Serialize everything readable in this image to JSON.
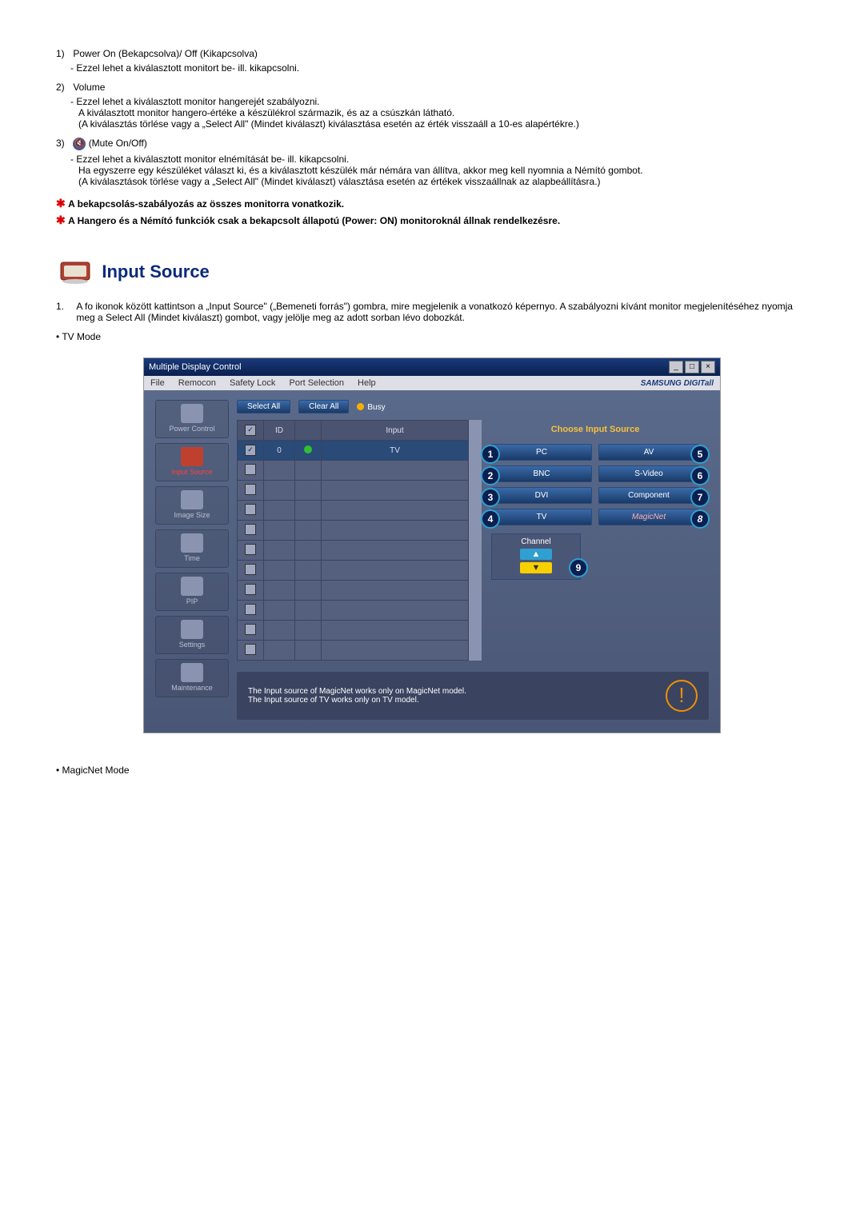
{
  "items": [
    {
      "num": "1)",
      "title": "Power On (Bekapcsolva)/ Off (Kikapcsolva)",
      "lines": [
        "- Ezzel lehet a kiválasztott monitort be- ill. kikapcsolni."
      ]
    },
    {
      "num": "2)",
      "title": "Volume",
      "lines": [
        "- Ezzel lehet a kiválasztott monitor hangerejét szabályozni.",
        "A kiválasztott monitor hangero-értéke a készülékrol származik, és az a csúszkán látható.",
        "(A kiválasztás törlése vagy a „Select All\" (Mindet kiválaszt) kiválasztása esetén az érték visszaáll a 10-es alapértékre.)"
      ]
    },
    {
      "num": "3)",
      "title": "(Mute On/Off)",
      "icon": true,
      "lines": [
        "- Ezzel lehet a kiválasztott monitor elnémítását be- ill. kikapcsolni.",
        "Ha egyszerre egy készüléket választ ki, és a kiválasztott készülék már némára van állítva, akkor meg kell nyomnia a Némító gombot.",
        "(A kiválasztások törlése vagy a „Select All\" (Mindet kiválaszt) választása esetén az értékek visszaállnak az alapbeállításra.)"
      ]
    }
  ],
  "notes": [
    "A bekapcsolás-szabályozás az összes monitorra vonatkozik.",
    "A Hangero és a Némító funkciók csak a bekapcsolt állapotú (Power: ON) monitoroknál állnak rendelkezésre."
  ],
  "heading": "Input Source",
  "para": {
    "num": "1.",
    "text": "A fo ikonok között kattintson a „Input Source\" („Bemeneti forrás\") gombra, mire megjelenik a vonatkozó képernyo. A szabályozni kívánt monitor megjelenítéséhez nyomja meg a Select All (Mindet kiválaszt) gombot, vagy jelölje meg az adott sorban lévo dobozkát."
  },
  "bullet_tv": "• TV Mode",
  "bullet_magic": "• MagicNet Mode",
  "app": {
    "title": "Multiple Display Control",
    "menu": [
      "File",
      "Remocon",
      "Safety Lock",
      "Port Selection",
      "Help"
    ],
    "brand": "SAMSUNG DIGITall",
    "select_all": "Select All",
    "clear_all": "Clear All",
    "busy": "Busy",
    "sidebar": [
      {
        "label": "Power Control",
        "active": false
      },
      {
        "label": "Input Source",
        "active": true
      },
      {
        "label": "Image Size",
        "active": false
      },
      {
        "label": "Time",
        "active": false
      },
      {
        "label": "PIP",
        "active": false
      },
      {
        "label": "Settings",
        "active": false
      },
      {
        "label": "Maintenance",
        "active": false
      }
    ],
    "grid_headers": {
      "c1": "",
      "c2": "ID",
      "c3": "",
      "c4": "Input"
    },
    "grid_row": {
      "id": "0",
      "input": "TV"
    },
    "panel_title": "Choose Input Source",
    "sources": {
      "pc": "PC",
      "av": "AV",
      "bnc": "BNC",
      "svideo": "S-Video",
      "dvi": "DVI",
      "component": "Component",
      "tv": "TV",
      "magicnet": "MagicNet"
    },
    "callouts": {
      "pc": "1",
      "bnc": "2",
      "dvi": "3",
      "tv": "4",
      "av": "5",
      "svideo": "6",
      "component": "7",
      "magicnet": "8",
      "channel": "9"
    },
    "channel_label": "Channel",
    "footer1": "The Input source of MagicNet works only on MagicNet model.",
    "footer2": "The Input source of TV works only on TV  model."
  }
}
